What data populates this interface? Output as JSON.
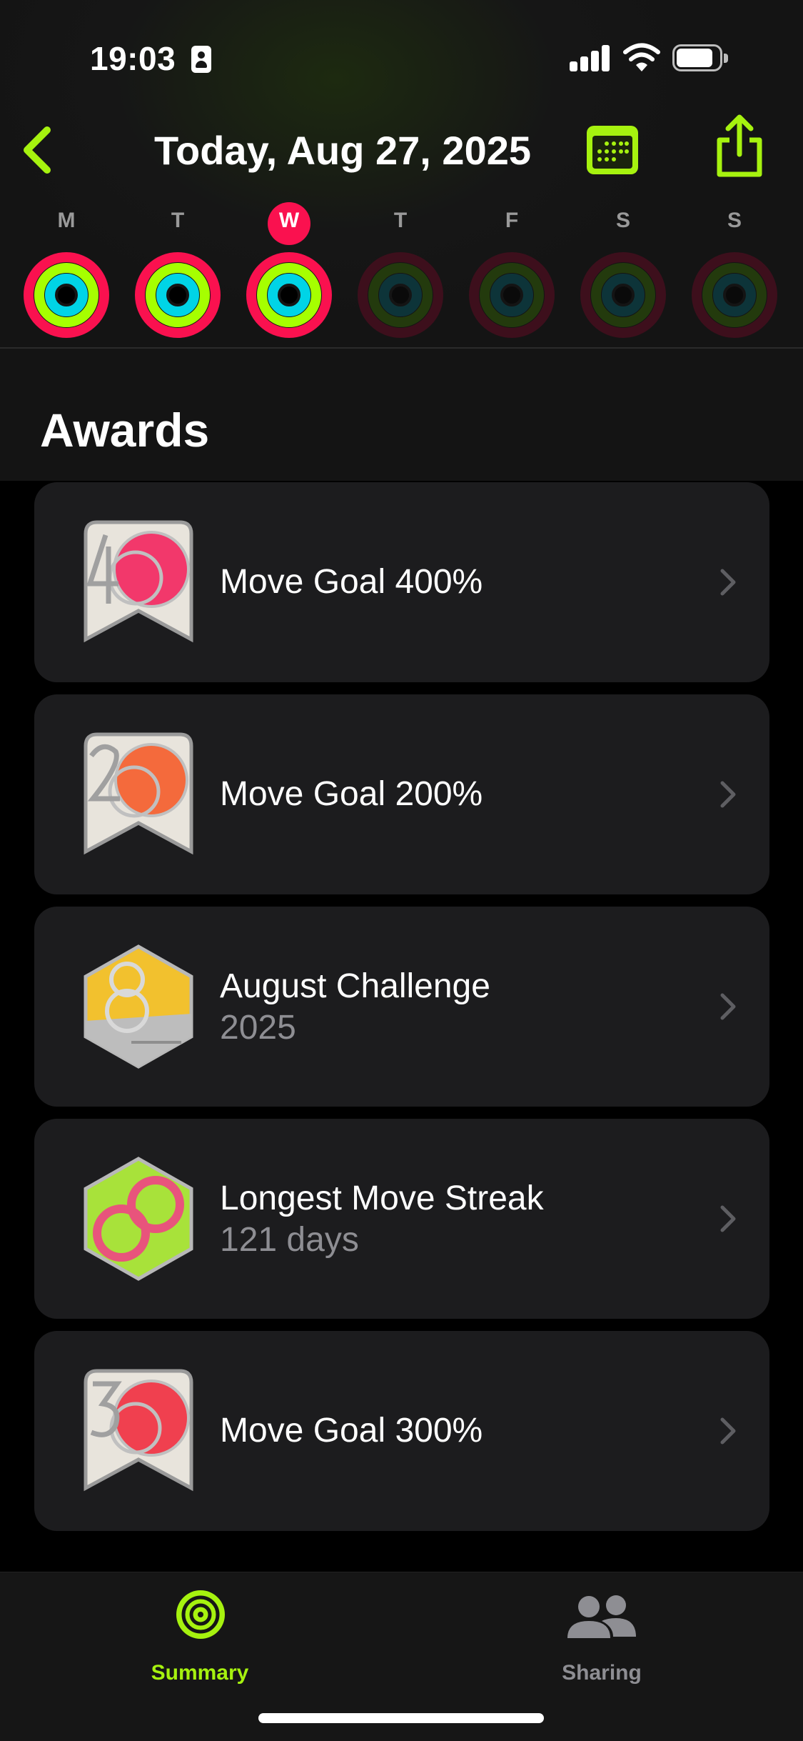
{
  "status_bar": {
    "time": "19:03"
  },
  "nav": {
    "title": "Today, Aug 27, 2025"
  },
  "week": {
    "days": [
      {
        "label": "M"
      },
      {
        "label": "T"
      },
      {
        "label": "W"
      },
      {
        "label": "T"
      },
      {
        "label": "F"
      },
      {
        "label": "S"
      },
      {
        "label": "S"
      }
    ],
    "today_index": 2
  },
  "section": {
    "title": "Awards"
  },
  "awards": [
    {
      "title": "Move Goal 400%",
      "subtitle": "",
      "icon": "move-goal-400-badge-icon"
    },
    {
      "title": "Move Goal 200%",
      "subtitle": "",
      "icon": "move-goal-200-badge-icon"
    },
    {
      "title": "August Challenge",
      "subtitle": "2025",
      "icon": "august-challenge-badge-icon"
    },
    {
      "title": "Longest Move Streak",
      "subtitle": "121 days",
      "icon": "longest-move-streak-badge-icon"
    },
    {
      "title": "Move Goal 300%",
      "subtitle": "",
      "icon": "move-goal-300-badge-icon"
    }
  ],
  "tabs": [
    {
      "label": "Summary",
      "icon": "summary-rings-icon",
      "active": true
    },
    {
      "label": "Sharing",
      "icon": "sharing-people-icon",
      "active": false
    }
  ],
  "colors": {
    "accent": "#a6f20f",
    "move": "#fa114f",
    "exercise": "#a6ff00",
    "stand": "#00d4e6",
    "card": "#1c1c1e",
    "today": "#fa114f"
  }
}
